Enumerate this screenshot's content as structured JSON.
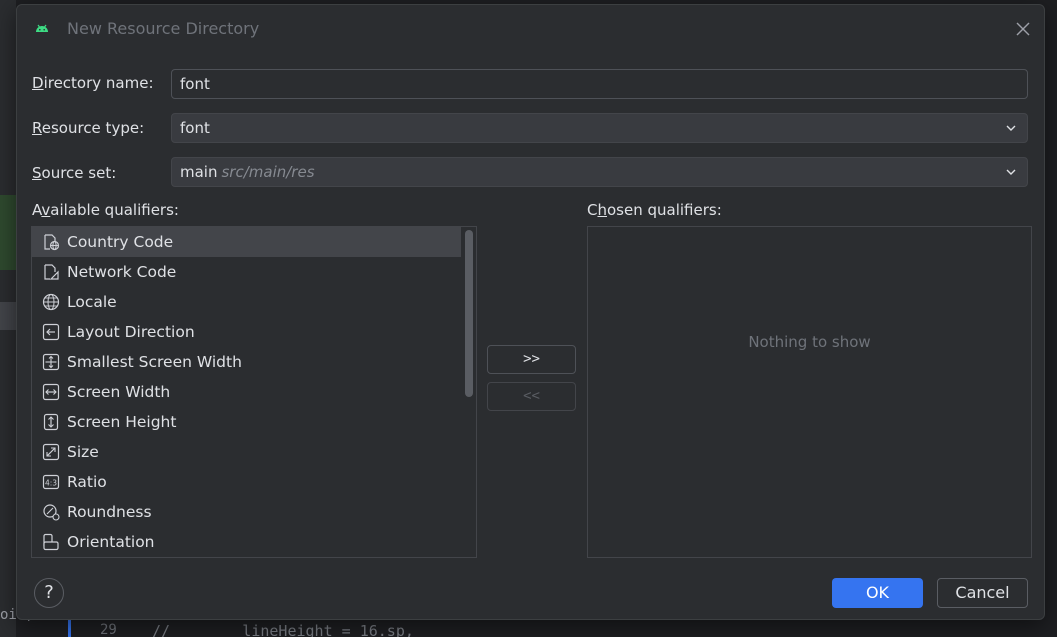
{
  "background": {
    "fragment": "oic,",
    "line_number": "29",
    "code": "//        lineHeight = 16.sp,"
  },
  "dialog": {
    "title": "New Resource Directory",
    "directory_name": {
      "label_u": "D",
      "label_rest": "irectory name:",
      "value": "font"
    },
    "resource_type": {
      "label_u": "R",
      "label_rest": "esource type:",
      "value": "font"
    },
    "source_set": {
      "label_u": "S",
      "label_rest": "ource set:",
      "value": "main",
      "hint": "src/main/res"
    },
    "available": {
      "label_pre": "A",
      "label_u": "v",
      "label_rest": "ailable qualifiers:",
      "items": [
        {
          "label": "Country Code",
          "icon": "country-code-icon"
        },
        {
          "label": "Network Code",
          "icon": "network-code-icon"
        },
        {
          "label": "Locale",
          "icon": "globe-icon"
        },
        {
          "label": "Layout Direction",
          "icon": "layout-direction-icon"
        },
        {
          "label": "Smallest Screen Width",
          "icon": "smallest-width-icon"
        },
        {
          "label": "Screen Width",
          "icon": "screen-width-icon"
        },
        {
          "label": "Screen Height",
          "icon": "screen-height-icon"
        },
        {
          "label": "Size",
          "icon": "size-icon"
        },
        {
          "label": "Ratio",
          "icon": "ratio-icon"
        },
        {
          "label": "Roundness",
          "icon": "roundness-icon"
        },
        {
          "label": "Orientation",
          "icon": "orientation-icon"
        }
      ]
    },
    "chosen": {
      "label_pre": "C",
      "label_u": "h",
      "label_rest": "osen qualifiers:",
      "empty": "Nothing to show"
    },
    "add_label": ">>",
    "remove_label": "<<",
    "help_label": "?",
    "ok_label": "OK",
    "cancel_label": "Cancel",
    "accent": "#3574f0"
  }
}
